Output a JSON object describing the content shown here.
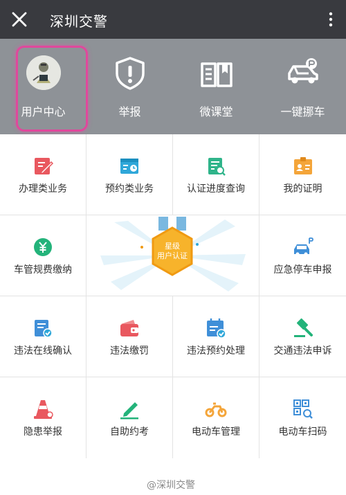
{
  "titlebar": {
    "title": "深圳交警"
  },
  "top_items": [
    {
      "label": "用户中心",
      "icon": "avatar-icon"
    },
    {
      "label": "举报",
      "icon": "alert-shield-icon"
    },
    {
      "label": "微课堂",
      "icon": "book-icon"
    },
    {
      "label": "一键挪车",
      "icon": "car-move-icon"
    }
  ],
  "grid": [
    {
      "label": "办理类业务",
      "icon": "edit-doc-icon",
      "color": "#e9585f"
    },
    {
      "label": "预约类业务",
      "icon": "calendar-clock-icon",
      "color": "#2fa7d9"
    },
    {
      "label": "认证进度查询",
      "icon": "doc-search-icon",
      "color": "#2fb48a"
    },
    {
      "label": "我的证明",
      "icon": "id-badge-icon",
      "color": "#f4a53a"
    },
    {
      "label": "车管规费缴纳",
      "icon": "yen-circle-icon",
      "color": "#23b37a"
    },
    {
      "label": "应急停车申报",
      "icon": "parking-car-icon",
      "color": "#3f8fd8"
    },
    {
      "label": "违法在线确认",
      "icon": "doc-check-icon",
      "color": "#3f8fd8"
    },
    {
      "label": "违法缴罚",
      "icon": "wallet-icon",
      "color": "#e9585f"
    },
    {
      "label": "违法预约处理",
      "icon": "calendar-check-icon",
      "color": "#3f8fd8"
    },
    {
      "label": "交通违法申诉",
      "icon": "gavel-icon",
      "color": "#23b37a"
    },
    {
      "label": "隐患举报",
      "icon": "traffic-cone-icon",
      "color": "#e9585f"
    },
    {
      "label": "自助约考",
      "icon": "pen-icon",
      "color": "#23b37a"
    },
    {
      "label": "电动车管理",
      "icon": "scooter-icon",
      "color": "#f4a53a"
    },
    {
      "label": "电动车扫码",
      "icon": "qr-scan-icon",
      "color": "#3f8fd8"
    }
  ],
  "banner": {
    "line1": "星级",
    "line2": "用户认证"
  },
  "watermark": "@深圳交警",
  "colors": {
    "titlebar": "#393a3f",
    "topbar": "#8e9297",
    "highlight": "#e0489c"
  }
}
